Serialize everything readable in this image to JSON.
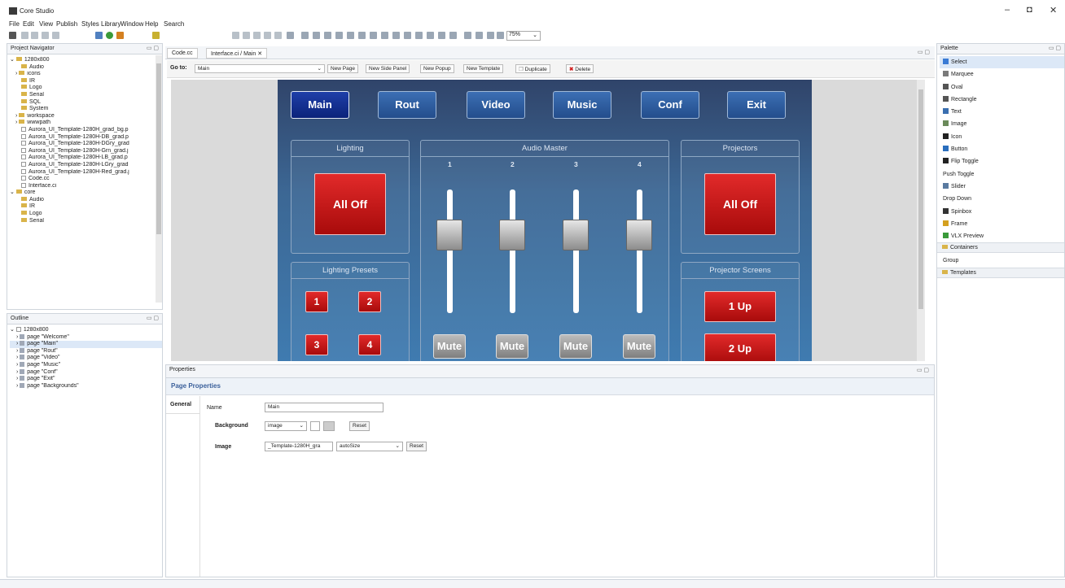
{
  "app": {
    "title": "Core Studio"
  },
  "menu": [
    "File",
    "Edit",
    "View",
    "Publish",
    "Styles Library",
    "Window",
    "Help",
    "Search"
  ],
  "toolbar": {
    "zoom": "75%"
  },
  "project_navigator": {
    "title": "Project Navigator",
    "tree": [
      {
        "label": "1280x800",
        "kind": "folder",
        "indent": 0,
        "arrow": "⌄"
      },
      {
        "label": "Audio",
        "kind": "folder",
        "indent": 2,
        "arrow": ""
      },
      {
        "label": "icons",
        "kind": "folder",
        "indent": 1,
        "arrow": "›"
      },
      {
        "label": "IR",
        "kind": "folder",
        "indent": 2,
        "arrow": ""
      },
      {
        "label": "Logo",
        "kind": "folder",
        "indent": 2,
        "arrow": ""
      },
      {
        "label": "Serial",
        "kind": "folder",
        "indent": 2,
        "arrow": ""
      },
      {
        "label": "SQL",
        "kind": "folder",
        "indent": 2,
        "arrow": ""
      },
      {
        "label": "System",
        "kind": "folder",
        "indent": 2,
        "arrow": ""
      },
      {
        "label": "workspace",
        "kind": "folder",
        "indent": 1,
        "arrow": "›"
      },
      {
        "label": "wwwpath",
        "kind": "folder",
        "indent": 1,
        "arrow": "›"
      },
      {
        "label": "Aurora_UI_Template-1280H_grad_bg.p",
        "kind": "file",
        "indent": 2,
        "arrow": ""
      },
      {
        "label": "Aurora_UI_Template-1280H-DB_grad.p",
        "kind": "file",
        "indent": 2,
        "arrow": ""
      },
      {
        "label": "Aurora_UI_Template-1280H-DGry_grad",
        "kind": "file",
        "indent": 2,
        "arrow": ""
      },
      {
        "label": "Aurora_UI_Template-1280H-Grn_grad.j",
        "kind": "file",
        "indent": 2,
        "arrow": ""
      },
      {
        "label": "Aurora_UI_Template-1280H-LB_grad.p",
        "kind": "file",
        "indent": 2,
        "arrow": ""
      },
      {
        "label": "Aurora_UI_Template-1280H-LGry_grad",
        "kind": "file",
        "indent": 2,
        "arrow": ""
      },
      {
        "label": "Aurora_UI_Template-1280H-Red_grad.j",
        "kind": "file",
        "indent": 2,
        "arrow": ""
      },
      {
        "label": "Code.cc",
        "kind": "file",
        "indent": 2,
        "arrow": ""
      },
      {
        "label": "Interface.ci",
        "kind": "file",
        "indent": 2,
        "arrow": ""
      },
      {
        "label": "core",
        "kind": "folder",
        "indent": 0,
        "arrow": "⌄"
      },
      {
        "label": "Audio",
        "kind": "folder",
        "indent": 2,
        "arrow": ""
      },
      {
        "label": "IR",
        "kind": "folder",
        "indent": 2,
        "arrow": ""
      },
      {
        "label": "Logo",
        "kind": "folder",
        "indent": 2,
        "arrow": ""
      },
      {
        "label": "Serial",
        "kind": "folder",
        "indent": 2,
        "arrow": ""
      }
    ]
  },
  "outline": {
    "title": "Outline",
    "root": "1280x800",
    "pages": [
      "page \"Welcome\"",
      "page \"Main\"",
      "page \"Rout\"",
      "page \"Video\"",
      "page \"Music\"",
      "page \"Conf\"",
      "page \"Exit\"",
      "page \"Backgrounds\""
    ],
    "selected_index": 1
  },
  "editor_tabs": [
    {
      "label": "Code.cc",
      "active": false
    },
    {
      "label": "Interface.ci / Main",
      "active": true
    }
  ],
  "goto": {
    "label": "Go to:",
    "value": "Main",
    "buttons": [
      "New Page",
      "New Side Panel",
      "New Popup",
      "New Template",
      "Duplicate",
      "Delete"
    ]
  },
  "ui": {
    "nav": [
      "Main",
      "Rout",
      "Video",
      "Music",
      "Conf",
      "Exit"
    ],
    "active_nav": "Main",
    "lighting": {
      "title": "Lighting",
      "button": "All Off"
    },
    "lighting_presets": {
      "title": "Lighting Presets",
      "buttons": [
        "1",
        "2",
        "3",
        "4"
      ]
    },
    "audio": {
      "title": "Audio Master",
      "channels": [
        "1",
        "2",
        "3",
        "4"
      ],
      "mute_label": "Mute",
      "fader_levels": [
        0.5,
        0.5,
        0.5,
        0.5
      ]
    },
    "projectors": {
      "title": "Projectors",
      "button": "All Off"
    },
    "projector_screens": {
      "title": "Projector Screens",
      "buttons": [
        "1 Up",
        "2 Up"
      ]
    }
  },
  "properties": {
    "tab": "Properties",
    "heading": "Page Properties",
    "side_tab": "General",
    "name_label": "Name",
    "name_value": "Main",
    "background_label": "Background",
    "background_value": "image",
    "reset_label": "Reset",
    "image_label": "Image",
    "image_value": "_Template-1280H_gra",
    "image_mode": "autoSize"
  },
  "palette": {
    "title": "Palette",
    "items": [
      {
        "label": "Select",
        "icon": "select-arrow-icon",
        "color": "#3a7bd5"
      },
      {
        "label": "Marquee",
        "icon": "marquee-icon",
        "color": "#7a7a7a"
      },
      {
        "label": "Oval",
        "icon": "oval-icon",
        "color": "#555555"
      },
      {
        "label": "Rectangle",
        "icon": "rectangle-icon",
        "color": "#555555"
      },
      {
        "label": "Text",
        "icon": "text-icon",
        "color": "#3a6fb0"
      },
      {
        "label": "Image",
        "icon": "image-icon",
        "color": "#6a8a5a"
      },
      {
        "label": "Icon",
        "icon": "icon-icon",
        "color": "#222222"
      },
      {
        "label": "Button",
        "icon": "button-icon",
        "color": "#2a6ebd"
      },
      {
        "label": "Flip Toggle",
        "icon": "flip-toggle-icon",
        "color": "#222222"
      },
      {
        "label": "Push Toggle",
        "icon": "",
        "color": ""
      },
      {
        "label": "Slider",
        "icon": "slider-icon",
        "color": "#5a7aa0"
      },
      {
        "label": "Drop Down",
        "icon": "",
        "color": ""
      },
      {
        "label": "Spinbox",
        "icon": "spinbox-icon",
        "color": "#333333"
      },
      {
        "label": "Frame",
        "icon": "frame-icon",
        "color": "#d4a020"
      },
      {
        "label": "VLX Preview",
        "icon": "vlx-preview-icon",
        "color": "#3a9a3a"
      }
    ],
    "containers_label": "Containers",
    "containers_items": [
      "Group"
    ],
    "templates_label": "Templates"
  },
  "colors": {
    "nav_button": "#2b5c9f",
    "nav_active": "#0f2c8f",
    "red_button": "#c41818",
    "stage_bg": "#3a5f8a"
  }
}
